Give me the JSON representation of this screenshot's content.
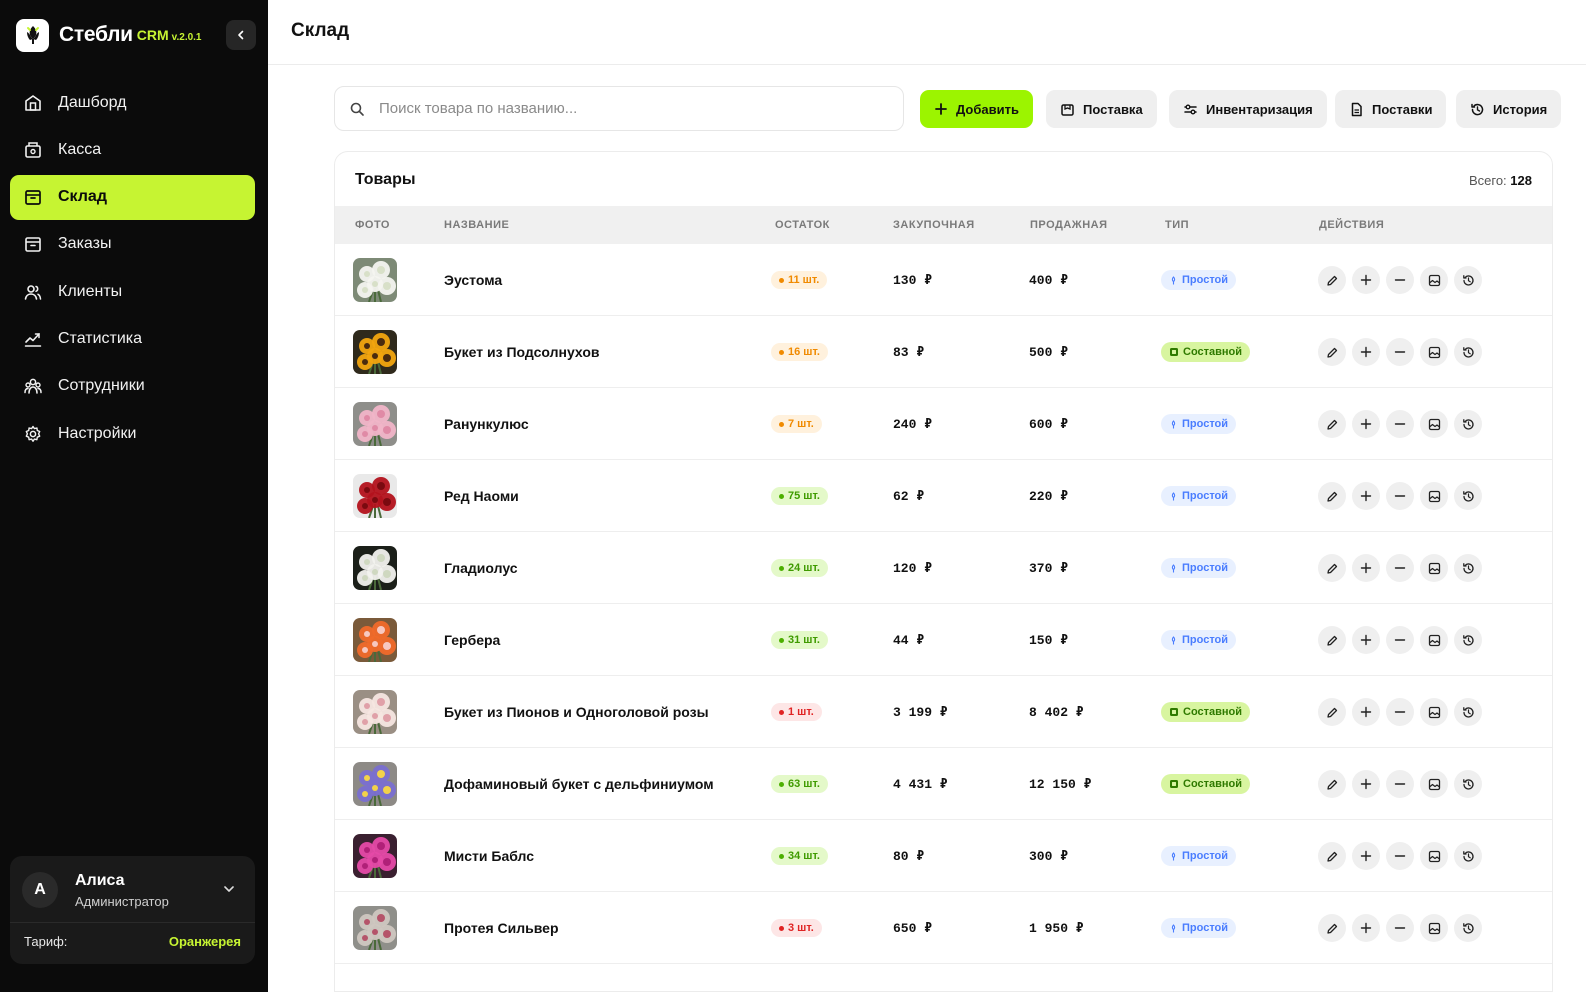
{
  "brand": {
    "name": "Стебли",
    "crm": "CRM",
    "version": "v.2.0.1"
  },
  "nav": [
    {
      "label": "Дашборд",
      "icon": "dashboard-icon",
      "active": false
    },
    {
      "label": "Касса",
      "icon": "cash-register-icon",
      "active": false
    },
    {
      "label": "Склад",
      "icon": "warehouse-icon",
      "active": true
    },
    {
      "label": "Заказы",
      "icon": "orders-icon",
      "active": false
    },
    {
      "label": "Клиенты",
      "icon": "clients-icon",
      "active": false
    },
    {
      "label": "Статистика",
      "icon": "statistics-icon",
      "active": false
    },
    {
      "label": "Сотрудники",
      "icon": "employees-icon",
      "active": false
    },
    {
      "label": "Настройки",
      "icon": "settings-icon",
      "active": false
    }
  ],
  "user": {
    "initial": "A",
    "name": "Алиса",
    "role": "Администратор",
    "plan_label": "Тариф:",
    "plan_value": "Оранжерея"
  },
  "page": {
    "title": "Склад"
  },
  "search": {
    "placeholder": "Поиск товара по названию..."
  },
  "toolbar": {
    "add": "Добавить",
    "delivery": "Поставка",
    "inventory": "Инвентаризация",
    "deliveries": "Поставки",
    "history": "История"
  },
  "products": {
    "title": "Товары",
    "total_label": "Всего:",
    "total": "128",
    "columns": {
      "photo": "ФОТО",
      "name": "НАЗВАНИЕ",
      "stock": "ОСТАТОК",
      "purchase": "ЗАКУПОЧНАЯ",
      "sale": "ПРОДАЖНАЯ",
      "type": "ТИП",
      "actions": "ДЕЙСТВИЯ"
    },
    "rows": [
      {
        "name": "Эустома",
        "stock": "11 шт.",
        "stock_level": "orange",
        "purchase": "130 ₽",
        "sale": "400 ₽",
        "type": "Простой",
        "type_kind": "simple",
        "photo": {
          "bg": "#7d8a76",
          "petal": "#f4f4f0",
          "center": "#d8e0c8"
        }
      },
      {
        "name": "Букет из Подсолнухов",
        "stock": "16 шт.",
        "stock_level": "orange",
        "purchase": "83 ₽",
        "sale": "500 ₽",
        "type": "Составной",
        "type_kind": "composite",
        "photo": {
          "bg": "#2f2a1c",
          "petal": "#f2a50f",
          "center": "#4a2b0e"
        }
      },
      {
        "name": "Ранункулюс",
        "stock": "7 шт.",
        "stock_level": "orange",
        "purchase": "240 ₽",
        "sale": "600 ₽",
        "type": "Простой",
        "type_kind": "simple",
        "photo": {
          "bg": "#8e8e8a",
          "petal": "#f1b5c8",
          "center": "#e08aa6"
        }
      },
      {
        "name": "Ред Наоми",
        "stock": "75 шт.",
        "stock_level": "green",
        "purchase": "62 ₽",
        "sale": "220 ₽",
        "type": "Простой",
        "type_kind": "simple",
        "photo": {
          "bg": "#e9e9e9",
          "petal": "#b3121c",
          "center": "#7a0a10"
        }
      },
      {
        "name": "Гладиолус",
        "stock": "24 шт.",
        "stock_level": "green",
        "purchase": "120 ₽",
        "sale": "370 ₽",
        "type": "Простой",
        "type_kind": "simple",
        "photo": {
          "bg": "#1b1f19",
          "petal": "#f2f2ee",
          "center": "#cfd8c0"
        }
      },
      {
        "name": "Гербера",
        "stock": "31 шт.",
        "stock_level": "green",
        "purchase": "44 ₽",
        "sale": "150 ₽",
        "type": "Простой",
        "type_kind": "simple",
        "photo": {
          "bg": "#7a5a3a",
          "petal": "#f06a2a",
          "center": "#f7c8c0"
        }
      },
      {
        "name": "Букет из Пионов и Одноголовой розы",
        "stock": "1 шт.",
        "stock_level": "red",
        "purchase": "3 199 ₽",
        "sale": "8 402 ₽",
        "type": "Составной",
        "type_kind": "composite",
        "photo": {
          "bg": "#9a8f84",
          "petal": "#f5e6e0",
          "center": "#e0a0a8"
        }
      },
      {
        "name": "Дофаминовый букет с дельфиниумом",
        "stock": "63 шт.",
        "stock_level": "green",
        "purchase": "4 431 ₽",
        "sale": "12 150 ₽",
        "type": "Составной",
        "type_kind": "composite",
        "photo": {
          "bg": "#8d8a86",
          "petal": "#7a6fd0",
          "center": "#f2d24a"
        }
      },
      {
        "name": "Мисти Баблс",
        "stock": "34 шт.",
        "stock_level": "green",
        "purchase": "80 ₽",
        "sale": "300 ₽",
        "type": "Простой",
        "type_kind": "simple",
        "photo": {
          "bg": "#3a2030",
          "petal": "#e54aa8",
          "center": "#b02078"
        }
      },
      {
        "name": "Протея Сильвер",
        "stock": "3 шт.",
        "stock_level": "red",
        "purchase": "650 ₽",
        "sale": "1 950 ₽",
        "type": "Простой",
        "type_kind": "simple",
        "photo": {
          "bg": "#8f8f8a",
          "petal": "#cfc7c0",
          "center": "#b5546a"
        }
      }
    ],
    "row_actions": [
      {
        "icon": "edit-icon"
      },
      {
        "icon": "plus-icon"
      },
      {
        "icon": "minus-icon"
      },
      {
        "icon": "image-icon"
      },
      {
        "icon": "history-icon"
      }
    ]
  },
  "colors": {
    "accent": "#c6f432",
    "primary_button": "#9cf400",
    "sidebar_bg": "#0b0b0b"
  }
}
